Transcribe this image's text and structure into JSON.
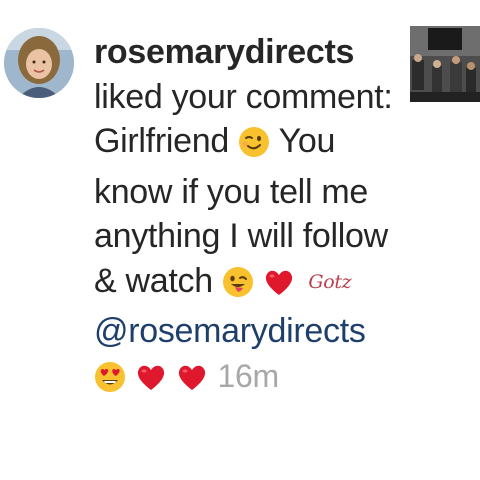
{
  "notification": {
    "username": "rosemarydirects",
    "action_text": "liked your comment:",
    "comment_lines": [
      "Girlfriend",
      "You know if you tell me anything I will follow & watch"
    ],
    "mention": "@rosemarydirects",
    "timestamp": "16m"
  },
  "signature": {
    "text": "Gotz"
  },
  "icons": {
    "wink": "winking-face-icon",
    "tongue_wink": "winking-face-with-tongue-icon",
    "heart": "red-heart-icon",
    "heart_eyes": "smiling-face-with-heart-eyes-icon"
  },
  "colors": {
    "text": "#262626",
    "mention": "#1f3f6b",
    "timestamp": "#a8a8a8",
    "heart": "#e0182d",
    "emoji_yellow": "#f7c22e"
  }
}
